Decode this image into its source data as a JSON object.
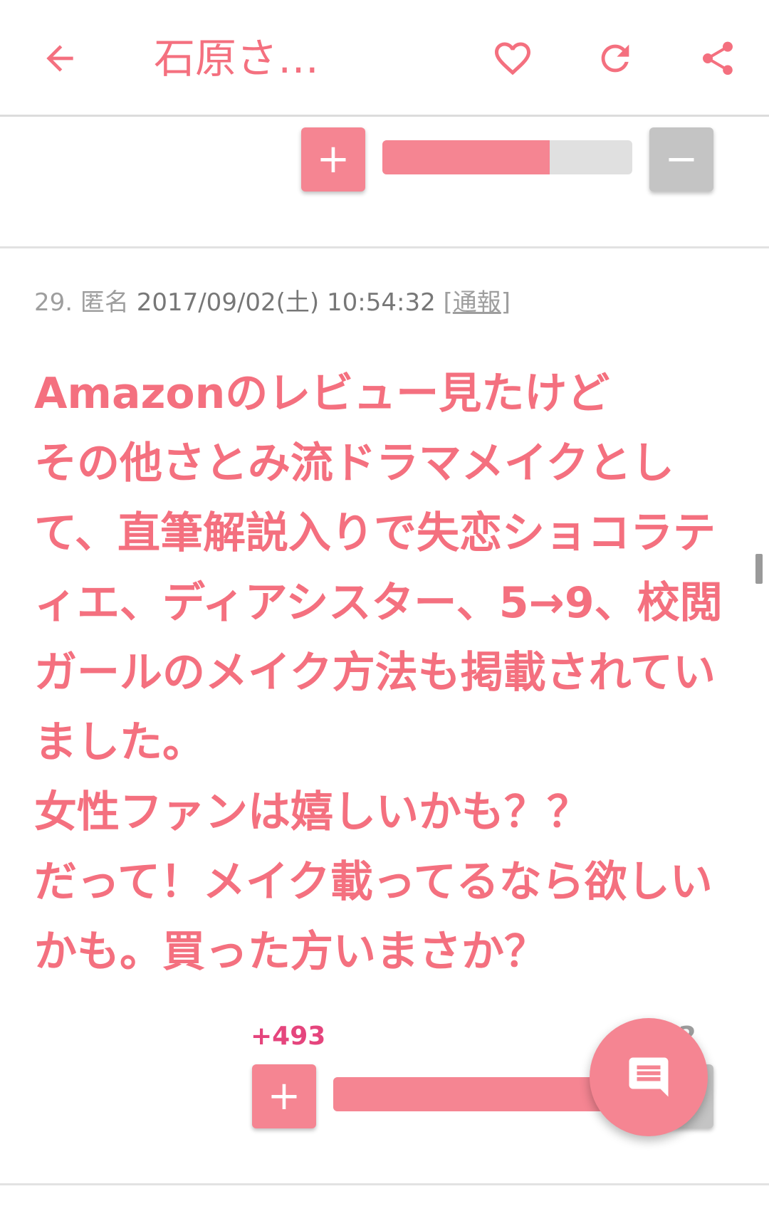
{
  "header": {
    "title": "石原さ…",
    "back_icon": "arrow-left-icon",
    "favorite_icon": "heart-icon",
    "reload_icon": "reload-icon",
    "share_icon": "share-icon",
    "accent_color": "#f4707f"
  },
  "previous_comment": {
    "plus_label": "+",
    "minus_label": "−",
    "plus_ratio": 0.67
  },
  "comment": {
    "number": "29.",
    "name": "匿名",
    "datetime": "2017/09/02(土) 10:54:32",
    "report_open": "[",
    "report_label": "通報",
    "report_close": "]",
    "lines": [
      "Amazonのレビュー見たけど",
      "その他さとみ流ドラマメイクとし",
      "て、直筆解説入りで失恋ショコラテ",
      "ィエ、ディアシスター、5→9、校閲",
      "ガールのメイク方法も掲載されてい",
      "ました。",
      "女性ファンは嬉しいかも？？",
      "だって！メイク載ってるなら欲しい",
      "かも。買った方いまさか？"
    ],
    "plus_score": "+493",
    "minus_score": "-2",
    "plus_label": "+",
    "minus_label": "−",
    "plus_ratio": 0.996,
    "text_color": "#f4707f",
    "plus_score_color": "#e5457d"
  },
  "fab": {
    "icon": "comment-icon"
  },
  "colors": {
    "vote_plus": "#f58592",
    "vote_minus": "#c4c4c4",
    "bar_track": "#e0e0e0"
  }
}
